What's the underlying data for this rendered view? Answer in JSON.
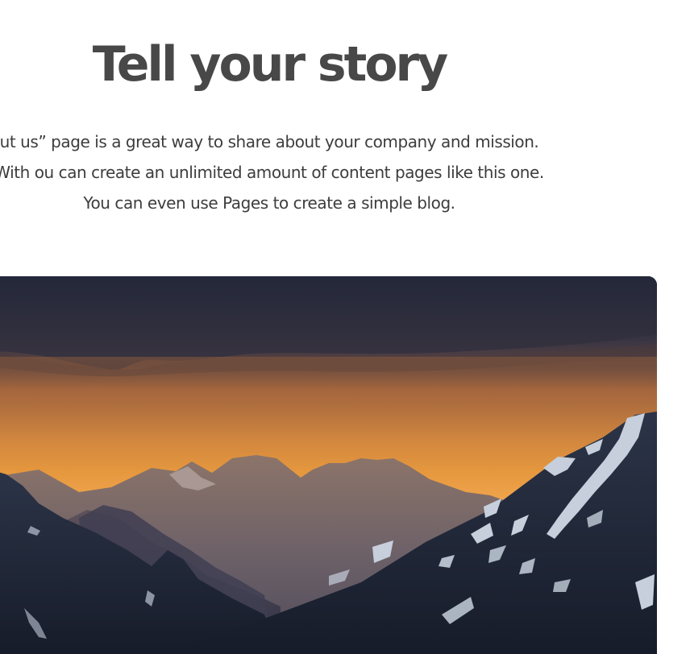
{
  "content": {
    "heading": "Tell your story",
    "description": "ut us” page is a great way to share about your company and mission. With ou can create an unlimited amount of content pages like this one. You can even use Pages to create a simple blog.",
    "image_icon": "mountain-landscape-photo"
  },
  "colors": {
    "heading": "#484848",
    "body_text": "#3d3d3d",
    "sky_dark": "#2a2f42",
    "sunset_orange": "#f0a34e",
    "mountain_dark": "#1f2635"
  }
}
